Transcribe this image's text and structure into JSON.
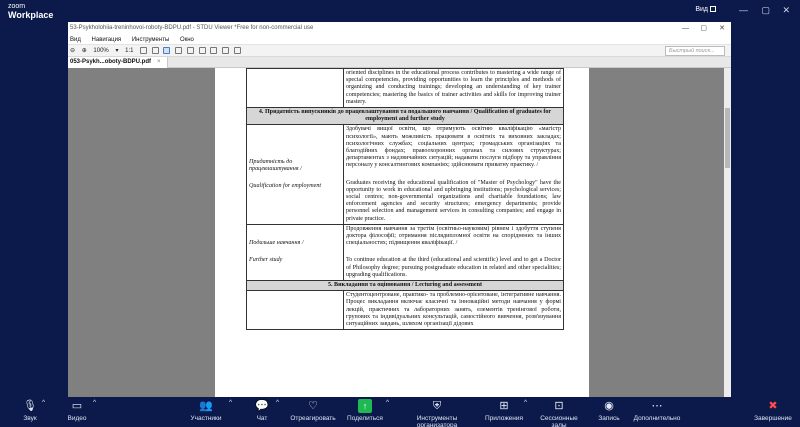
{
  "zoom": {
    "logo_line1": "zoom",
    "logo_line2": "Workplace",
    "view_label": "Вид",
    "window_controls": [
      "—",
      "▢",
      "✕"
    ]
  },
  "viewer": {
    "title": "53-Psykholohiia-treninhovoi-roboty-BDPU.pdf - STDU Viewer *Free for non-commercial use",
    "menu": [
      "Вид",
      "Навигация",
      "Инструменты",
      "Окно"
    ],
    "search_placeholder": "Быстрый поиск...",
    "zoom_level": "100%",
    "page_field": "1:1",
    "tab_label": "053-Psykh...oboty-BDPU.pdf",
    "tab_close": "×"
  },
  "document": {
    "row_top_text": "oriented disciplines in the educational process contributes to mastering a wide range of special competencies, providing opportunities to learn the principles and methods of organizing and conducting trainings; developing an understanding of key trainer competencies; mastering the basics of trainer activities and skills for improving trainer mastery.",
    "section4_header": "4. Придатність випускників до працевлаштування та подальшого навчання / Qualification of graduates for employment and further study",
    "employment_label_ua": "Придатність до працевлаштування /",
    "employment_label_en": "Qualification for employment",
    "employment_text_ua": "Здобувачі вищої освіти, що отримують освітню кваліфікацію «магістр психології», мають можливість працювати в освітніх та виховних закладах; психологічних службах; соціальних центрах; громадських організаціях та благодійних фондах; правоохоронних органах та силових структурах; департаментах з надзвичайних ситуацій; надавати послуги підбору та управління персоналу у консалтингових компаніях; здійснювати приватну практику. /",
    "employment_text_en": "Graduates receiving the educational qualification of \"Master of Psychology\" have the opportunity to work in educational and upbringing institutions; psychological services; social centres; non-governmental organizations and charitable foundations; law enforcement agencies and security structures; emergency departments; provide personnel selection and management services in consulting companies; and engage in private practice.",
    "further_label_ua": "Подальше навчання /",
    "further_label_en": "Further study",
    "further_text_ua": "Продовження навчання за третім (освітньо-науковим) рівнем і здобуття ступеня доктора філософії; отримання післядипломної освіти на споріднених та інших спеціальностях; підвищення кваліфікації. /",
    "further_text_en": "To continue education at the third (educational and scientific) level and to get a Doctor of Philosophy degree; pursuing postgraduate education in related and other specialities; upgrading qualifications.",
    "section5_header": "5. Викладання та оцінювання / Lecturing and assessment",
    "section5_text": "Студентоцентроване, практико- та проблемно-орієнтоване, інтегративне навчання. Процес викладання включає класичні та інноваційні методи навчання у формі лекцій, практичних та лабораторних занять, елементів тренінгової роботи, групових та індивідуальних консультацій, самостійного вивчення, розв'язування ситуаційних завдань, шляхом організації дідових"
  },
  "controls": [
    {
      "label": "Звук"
    },
    {
      "label": "Видео"
    },
    {
      "label": "Участники"
    },
    {
      "label": "Чат"
    },
    {
      "label": "Отреагировать"
    },
    {
      "label": "Поделиться"
    },
    {
      "label": "Инструменты организатора"
    },
    {
      "label": "Приложения"
    },
    {
      "label": "Сессионные залы"
    },
    {
      "label": "Запись"
    },
    {
      "label": "Дополнительно"
    },
    {
      "label": "Завершение"
    }
  ],
  "colors": {
    "zoom_bg": "#0b1a4a",
    "share_green": "#1fb954",
    "end_red": "#ff4b4b",
    "viewer_gray": "#808080"
  }
}
